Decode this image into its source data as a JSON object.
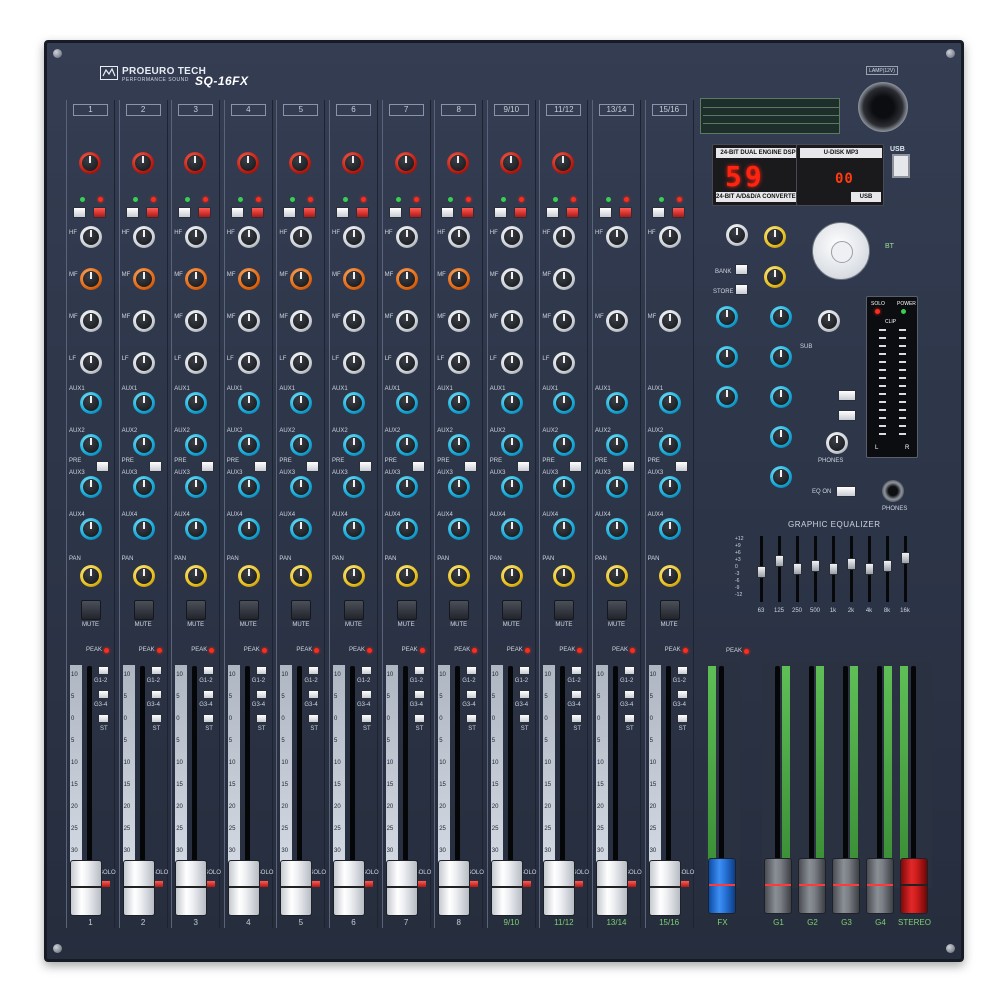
{
  "brand": {
    "name": "PROEURO TECH",
    "sub": "PERFORMANCE SOUND",
    "model": "SQ-16FX",
    "lamp": "LAMP(12V)"
  },
  "channels": [
    {
      "number": "1",
      "bottom": "1"
    },
    {
      "number": "2",
      "bottom": "2"
    },
    {
      "number": "3",
      "bottom": "3"
    },
    {
      "number": "4",
      "bottom": "4"
    },
    {
      "number": "5",
      "bottom": "5"
    },
    {
      "number": "6",
      "bottom": "6"
    },
    {
      "number": "7",
      "bottom": "7"
    },
    {
      "number": "8",
      "bottom": "8"
    },
    {
      "number": "9/10",
      "bottom": "9/10"
    },
    {
      "number": "11/12",
      "bottom": "11/12"
    },
    {
      "number": "13/14",
      "bottom": "13/14"
    },
    {
      "number": "15/16",
      "bottom": "15/16"
    }
  ],
  "labels": {
    "mute": "MUTE",
    "peak": "PEAK",
    "solo": "SOLO",
    "pan": "PAN",
    "pre": "PRE",
    "hf": "HF",
    "mf": "MF",
    "lf": "LF",
    "aux1": "AUX1",
    "aux2": "AUX2",
    "aux3": "AUX3",
    "aux4": "AUX4",
    "g12": "G1-2",
    "g34": "G3-4",
    "st": "ST"
  },
  "fader_scale": [
    "10",
    "5",
    "0",
    "5",
    "10",
    "15",
    "20",
    "25",
    "30"
  ],
  "displays": {
    "dsp_header": "24-BIT DUAL ENGINE DSP",
    "dsp_footer": "24-BIT A/D&D/A CONVERTER",
    "dsp_value": "59",
    "mp3_header": "U-DISK MP3",
    "mp3_value": "00",
    "mp3_footer": "USB",
    "usb": "USB"
  },
  "master": {
    "bank": "BANK",
    "store": "STORE",
    "sub": "SUB",
    "phones": "PHONES",
    "eq_on": "EQ ON",
    "bt": "BT",
    "solo_led": "SOLO",
    "power_led": "POWER",
    "clip": "CLIP",
    "meter_l": "L",
    "meter_r": "R"
  },
  "geq": {
    "title": "GRAPHIC EQUALIZER",
    "bands": [
      "63",
      "125",
      "250",
      "500",
      "1k",
      "2k",
      "4k",
      "8k",
      "16k"
    ],
    "scale": [
      "+12",
      "+9",
      "+6",
      "+3",
      "0",
      "-3",
      "-6",
      "-9",
      "-12"
    ],
    "levels": [
      0.55,
      0.35,
      0.5,
      0.45,
      0.5,
      0.4,
      0.5,
      0.45,
      0.3
    ]
  },
  "bus_labels": [
    "FX",
    "G1",
    "G2",
    "G3",
    "G4",
    "STEREO"
  ]
}
